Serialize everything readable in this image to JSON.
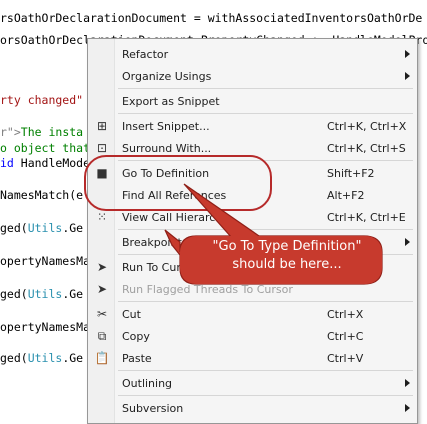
{
  "editor": {
    "lines": [
      {
        "segments": [
          {
            "t": "rsOathOrDeclarationDocument = withAssociatedInventorsOathOrDe",
            "c": ""
          }
        ]
      },
      {
        "segments": [
          {
            "t": "orsOathOrDeclarationDocument.PropertyChanged += HandleModelProp",
            "c": ""
          }
        ]
      },
      {
        "segments": [
          {
            "t": "rty changed\"",
            "c": "tk-str"
          }
        ]
      },
      {
        "segments": [
          {
            "t": "r\">",
            "c": "tk-doc"
          },
          {
            "t": "The insta",
            "c": "tk-cmt"
          }
        ]
      },
      {
        "segments": [
          {
            "t": "o object that",
            "c": "tk-cmt"
          }
        ]
      },
      {
        "segments": [
          {
            "t": "id ",
            "c": "tk-kw"
          },
          {
            "t": "HandleMode",
            "c": ""
          }
        ]
      },
      {
        "segments": [
          {
            "t": "NamesMatch(e",
            "c": ""
          }
        ]
      },
      {
        "segments": [
          {
            "t": "ged(",
            "c": ""
          },
          {
            "t": "Utils",
            "c": "tk-typ"
          },
          {
            "t": ".Ge",
            "c": ""
          }
        ]
      },
      {
        "segments": [
          {
            "t": "opertyNamesMat",
            "c": ""
          }
        ]
      },
      {
        "segments": [
          {
            "t": "ged(",
            "c": ""
          },
          {
            "t": "Utils",
            "c": "tk-typ"
          },
          {
            "t": ".Ge",
            "c": ""
          }
        ]
      },
      {
        "segments": [
          {
            "t": "opertyNamesMa",
            "c": ""
          }
        ]
      },
      {
        "segments": [
          {
            "t": "ged(",
            "c": ""
          },
          {
            "t": "Utils",
            "c": "tk-typ"
          },
          {
            "t": ".Ge",
            "c": ""
          }
        ]
      }
    ]
  },
  "menu": {
    "items": [
      {
        "label": "Refactor",
        "shortcut": "",
        "icon": "",
        "submenu": true,
        "disabled": false
      },
      {
        "label": "Organize Usings",
        "shortcut": "",
        "icon": "",
        "submenu": true,
        "disabled": false
      },
      {
        "separator": true
      },
      {
        "label": "Export as Snippet",
        "shortcut": "",
        "icon": "",
        "submenu": false,
        "disabled": false
      },
      {
        "separator": true
      },
      {
        "label": "Insert Snippet...",
        "shortcut": "Ctrl+K, Ctrl+X",
        "icon": "insert-snippet-icon",
        "submenu": false,
        "disabled": false
      },
      {
        "label": "Surround With...",
        "shortcut": "Ctrl+K, Ctrl+S",
        "icon": "surround-with-icon",
        "submenu": false,
        "disabled": false
      },
      {
        "separator": true
      },
      {
        "label": "Go To Definition",
        "shortcut": "Shift+F2",
        "icon": "go-to-definition-icon",
        "submenu": false,
        "disabled": false
      },
      {
        "label": "Find All References",
        "shortcut": "Alt+F2",
        "icon": "",
        "submenu": false,
        "disabled": false
      },
      {
        "label": "View Call Hierarchy",
        "shortcut": "Ctrl+K, Ctrl+E",
        "icon": "call-hierarchy-icon",
        "submenu": false,
        "disabled": false
      },
      {
        "separator": true
      },
      {
        "label": "Breakpoint",
        "shortcut": "",
        "icon": "",
        "submenu": true,
        "disabled": false
      },
      {
        "separator": true
      },
      {
        "label": "Run To Cursor",
        "shortcut": "",
        "icon": "run-to-cursor-icon",
        "submenu": false,
        "disabled": false
      },
      {
        "label": "Run Flagged Threads To Cursor",
        "shortcut": "",
        "icon": "run-flagged-threads-icon",
        "submenu": false,
        "disabled": true
      },
      {
        "separator": true
      },
      {
        "label": "Cut",
        "shortcut": "Ctrl+X",
        "icon": "cut-icon",
        "submenu": false,
        "disabled": false
      },
      {
        "label": "Copy",
        "shortcut": "Ctrl+C",
        "icon": "copy-icon",
        "submenu": false,
        "disabled": false
      },
      {
        "label": "Paste",
        "shortcut": "Ctrl+V",
        "icon": "paste-icon",
        "submenu": false,
        "disabled": false
      },
      {
        "separator": true
      },
      {
        "label": "Outlining",
        "shortcut": "",
        "icon": "",
        "submenu": true,
        "disabled": false
      },
      {
        "separator": true
      },
      {
        "label": "Subversion",
        "shortcut": "",
        "icon": "",
        "submenu": true,
        "disabled": false
      }
    ]
  },
  "annotation": {
    "callout_line1": "\"Go To Type Definition\"",
    "callout_line2": "should be here...",
    "color": "#c0392b"
  },
  "icons": {
    "insert-snippet-icon": "⊞",
    "surround-with-icon": "⊡",
    "go-to-definition-icon": "■",
    "call-hierarchy-icon": "⁙",
    "run-to-cursor-icon": "➤",
    "run-flagged-threads-icon": "➤",
    "cut-icon": "✂",
    "copy-icon": "⧉",
    "paste-icon": "📋"
  }
}
